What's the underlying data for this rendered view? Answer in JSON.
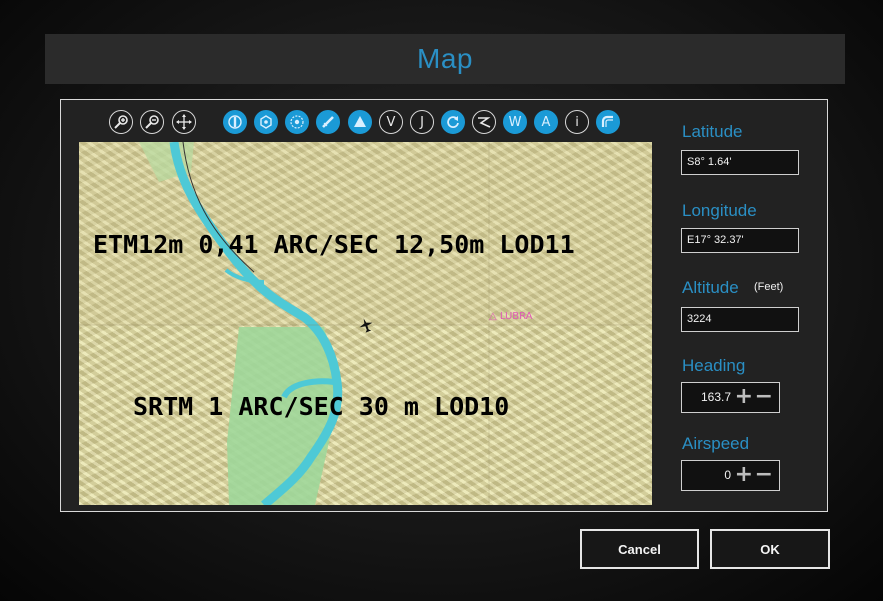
{
  "window": {
    "title": "Map"
  },
  "toolbar": {
    "tools": [
      {
        "icon": "zoom-in-icon",
        "glyph": "",
        "style": "light"
      },
      {
        "icon": "zoom-out-icon",
        "glyph": "",
        "style": "light"
      },
      {
        "icon": "pan-move-icon",
        "glyph": "",
        "style": "light"
      },
      {
        "icon": "airport-filter-icon",
        "glyph": "",
        "style": "blue"
      },
      {
        "icon": "ndb-filter-icon",
        "glyph": "",
        "style": "blue"
      },
      {
        "icon": "vor-filter-icon",
        "glyph": "",
        "style": "blue"
      },
      {
        "icon": "runway-filter-icon",
        "glyph": "",
        "style": "blue"
      },
      {
        "icon": "waypoint-filter-icon",
        "glyph": "",
        "style": "blue"
      },
      {
        "icon": "v-layer-icon",
        "glyph": "V",
        "style": "light"
      },
      {
        "icon": "j-layer-icon",
        "glyph": "J",
        "style": "light"
      },
      {
        "icon": "refresh-icon",
        "glyph": "",
        "style": "blue"
      },
      {
        "icon": "route-icon",
        "glyph": "",
        "style": "light"
      },
      {
        "icon": "w-layer-icon",
        "glyph": "W",
        "style": "blue"
      },
      {
        "icon": "a-layer-icon",
        "glyph": "A",
        "style": "blue"
      },
      {
        "icon": "info-icon",
        "glyph": "i",
        "style": "light"
      },
      {
        "icon": "follow-aircraft-icon",
        "glyph": "",
        "style": "blue"
      }
    ]
  },
  "map": {
    "lod11_label": "ETM12m 0,41 ARC/SEC 12,50m LOD11",
    "lod10_label": "SRTM 1 ARC/SEC 30 m LOD10",
    "place_label": "LUBRA",
    "aircraft_icon": "aircraft-icon",
    "colors": {
      "terrain": "#e2dda3",
      "river": "#4ec9d6",
      "forest": "#9fd79a"
    }
  },
  "fields": {
    "latitude": {
      "label": "Latitude",
      "value": "S8° 1.64'"
    },
    "longitude": {
      "label": "Longitude",
      "value": "E17° 32.37'"
    },
    "altitude": {
      "label": "Altitude",
      "unit": "(Feet)",
      "value": "3224"
    },
    "heading": {
      "label": "Heading",
      "value": "163.7"
    },
    "airspeed": {
      "label": "Airspeed",
      "value": "0"
    }
  },
  "buttons": {
    "cancel": "Cancel",
    "ok": "OK"
  },
  "theme": {
    "accent": "#2a8fc4",
    "tool_blue": "#1b9ad6"
  }
}
